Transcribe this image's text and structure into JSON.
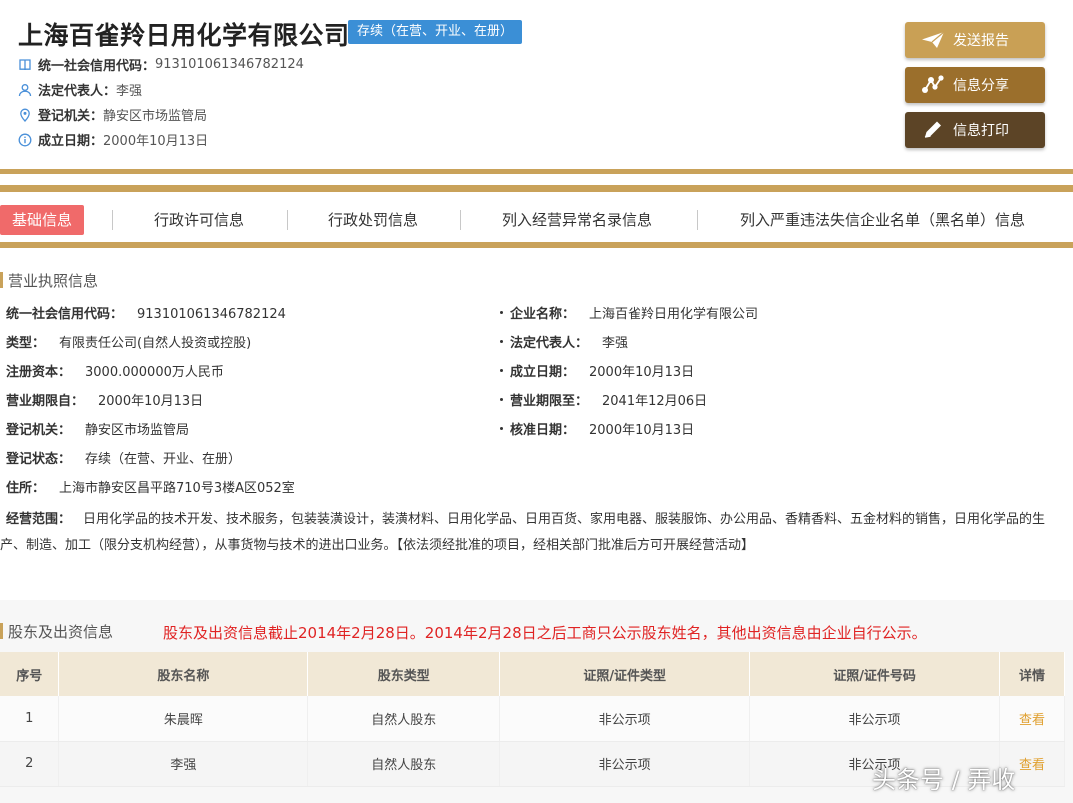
{
  "header": {
    "company_name": "上海百雀羚日用化学有限公司",
    "status": "存续（在营、开业、在册）",
    "meta": [
      {
        "label": "统一社会信用代码：",
        "value": "913101061346782124"
      },
      {
        "label": "法定代表人：",
        "value": "李强"
      },
      {
        "label": "登记机关：",
        "value": "静安区市场监管局"
      },
      {
        "label": "成立日期：",
        "value": "2000年10月13日"
      }
    ]
  },
  "actions": {
    "send_report": "发送报告",
    "share_info": "信息分享",
    "print_info": "信息打印"
  },
  "tabs": [
    {
      "label": "基础信息",
      "active": true
    },
    {
      "label": "行政许可信息",
      "active": false
    },
    {
      "label": "行政处罚信息",
      "active": false
    },
    {
      "label": "列入经营异常名录信息",
      "active": false
    },
    {
      "label": "列入严重违法失信企业名单（黑名单）信息",
      "active": false
    }
  ],
  "license": {
    "section_title": "营业执照信息",
    "left": [
      {
        "label": "统一社会信用代码：",
        "value": "913101061346782124"
      },
      {
        "label": "类型：",
        "value": "有限责任公司(自然人投资或控股)"
      },
      {
        "label": "注册资本：",
        "value": "3000.000000万人民币"
      },
      {
        "label": "营业期限自：",
        "value": "2000年10月13日"
      },
      {
        "label": "登记机关：",
        "value": "静安区市场监管局"
      },
      {
        "label": "登记状态：",
        "value": "存续（在营、开业、在册）"
      },
      {
        "label": "住所：",
        "value": "上海市静安区昌平路710号3楼A区052室"
      }
    ],
    "right": [
      {
        "label": "企业名称：",
        "value": "上海百雀羚日用化学有限公司"
      },
      {
        "label": "法定代表人：",
        "value": "李强"
      },
      {
        "label": "成立日期：",
        "value": "2000年10月13日"
      },
      {
        "label": "营业期限至：",
        "value": "2041年12月06日"
      },
      {
        "label": "核准日期：",
        "value": "2000年10月13日"
      }
    ],
    "scope_label": "经营范围：",
    "scope_value": "日用化学品的技术开发、技术服务，包装装潢设计，装潢材料、日用化学品、日用百货、家用电器、服装服饰、办公用品、香精香料、五金材料的销售，日用化学品的生产、制造、加工（限分支机构经营），从事货物与技术的进出口业务。【依法须经批准的项目，经相关部门批准后方可开展经营活动】"
  },
  "shareholders": {
    "section_title": "股东及出资信息",
    "notice": "股东及出资信息截止2014年2月28日。2014年2月28日之后工商只公示股东姓名，其他出资信息由企业自行公示。",
    "columns": [
      "序号",
      "股东名称",
      "股东类型",
      "证照/证件类型",
      "证照/证件号码",
      "详情"
    ],
    "rows": [
      [
        "1",
        "朱晨晖",
        "自然人股东",
        "非公示项",
        "非公示项",
        "查看"
      ],
      [
        "2",
        "李强",
        "自然人股东",
        "非公示项",
        "非公示项",
        "查看"
      ]
    ]
  },
  "watermark": "头条号 / 弄收",
  "colors": {
    "gold": "#c9a25a",
    "status_blue": "#3b8fd6",
    "active_tab": "#f06a6a",
    "notice_red": "#e02323",
    "link_orange": "#e0a030"
  }
}
